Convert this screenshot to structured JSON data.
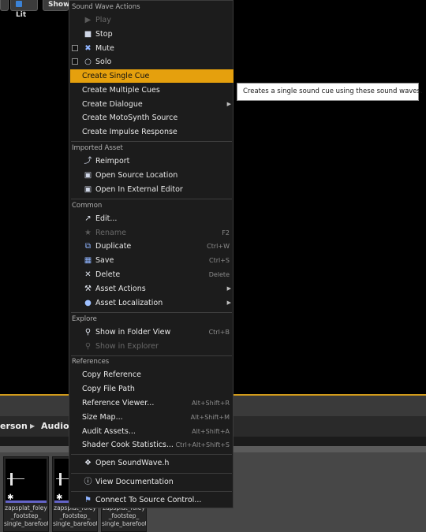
{
  "viewport": {
    "buttons": [
      {
        "label": "",
        "icon": "perspective-icon"
      },
      {
        "label": "Lit",
        "icon": "lit-sphere-icon"
      },
      {
        "label": "Show",
        "icon": ""
      }
    ]
  },
  "content_browser": {
    "breadcrumbs": [
      "erson",
      "Audio"
    ],
    "assets": [
      {
        "label": "zapsplat_foley\n_footstep_\nsingle_barefoot"
      },
      {
        "label": "zapsplat_foley\n_footstep_\nsingle_barefoot"
      },
      {
        "label": "zapsplat_foley\n_footstep_\nsingle_barefoot"
      }
    ]
  },
  "menu": {
    "sound_wave_header": "Sound Wave Actions",
    "sound_wave_items": [
      {
        "label": "Play",
        "icon": "play-icon",
        "disabled": true
      },
      {
        "label": "Stop",
        "icon": "stop-icon"
      },
      {
        "label": "Mute",
        "icon": "mute-icon",
        "checkbox": true
      },
      {
        "label": "Solo",
        "icon": "headphones-icon",
        "checkbox": true
      }
    ],
    "create_items": [
      {
        "label": "Create Single Cue",
        "highlighted": true
      },
      {
        "label": "Create Multiple Cues"
      },
      {
        "label": "Create Dialogue",
        "submenu": true
      },
      {
        "label": "Create MotoSynth Source"
      },
      {
        "label": "Create Impulse Response"
      }
    ],
    "imported_header": "Imported Asset",
    "imported_items": [
      {
        "label": "Reimport",
        "icon": "reimport-icon"
      },
      {
        "label": "Open Source Location",
        "icon": "folder-open-icon"
      },
      {
        "label": "Open In External Editor",
        "icon": "external-editor-icon"
      }
    ],
    "common_header": "Common",
    "common_items": [
      {
        "label": "Edit...",
        "icon": "edit-icon"
      },
      {
        "label": "Rename",
        "icon": "rename-icon",
        "shortcut": "F2",
        "disabled": true
      },
      {
        "label": "Duplicate",
        "icon": "duplicate-icon",
        "shortcut": "Ctrl+W"
      },
      {
        "label": "Save",
        "icon": "save-icon",
        "shortcut": "Ctrl+S"
      },
      {
        "label": "Delete",
        "icon": "delete-icon",
        "shortcut": "Delete"
      },
      {
        "label": "Asset Actions",
        "icon": "wrench-icon",
        "submenu": true
      },
      {
        "label": "Asset Localization",
        "icon": "globe-icon",
        "submenu": true
      }
    ],
    "explore_header": "Explore",
    "explore_items": [
      {
        "label": "Show in Folder View",
        "icon": "search-icon",
        "shortcut": "Ctrl+B"
      },
      {
        "label": "Show in Explorer",
        "icon": "search-icon",
        "disabled": true
      }
    ],
    "references_header": "References",
    "references_items": [
      {
        "label": "Copy Reference"
      },
      {
        "label": "Copy File Path"
      },
      {
        "label": "Reference Viewer...",
        "shortcut": "Alt+Shift+R"
      },
      {
        "label": "Size Map...",
        "shortcut": "Alt+Shift+M"
      },
      {
        "label": "Audit Assets...",
        "shortcut": "Alt+Shift+A"
      },
      {
        "label": "Shader Cook Statistics...",
        "shortcut": "Ctrl+Alt+Shift+S"
      }
    ],
    "open_header_item": {
      "label": "Open SoundWave.h",
      "icon": "code-file-icon"
    },
    "documentation_item": {
      "label": "View Documentation",
      "icon": "help-icon"
    },
    "source_control_item": {
      "label": "Connect To Source Control...",
      "icon": "source-control-icon"
    }
  },
  "tooltip": {
    "text": "Creates a single sound cue using these sound waves."
  },
  "colors": {
    "highlight": "#e5a00d",
    "accent_line": "#d09a1a",
    "menu_background": "#1c1c1c"
  }
}
